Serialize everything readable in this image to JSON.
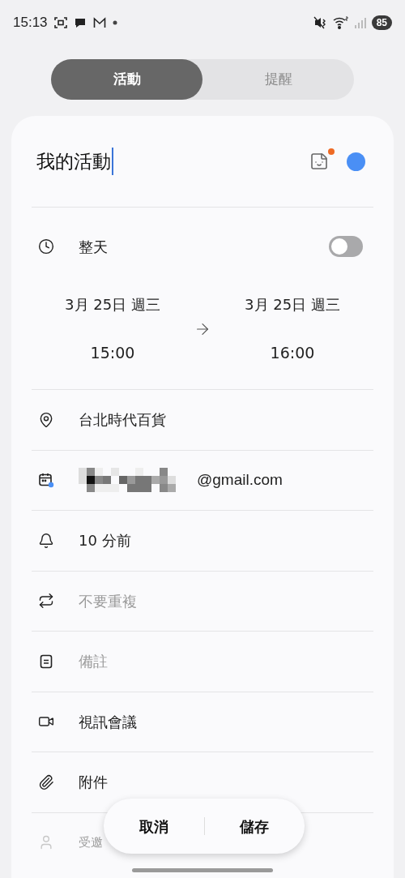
{
  "status_bar": {
    "time": "15:13",
    "battery": "85"
  },
  "tabs": [
    {
      "label": "活動",
      "selected": true
    },
    {
      "label": "提醒",
      "selected": false
    }
  ],
  "title": {
    "value": "我的活動",
    "color": "#4a8ff5",
    "sticker_badge": true
  },
  "all_day": {
    "label": "整天",
    "on": false
  },
  "start": {
    "date": "3月 25日 週三",
    "time": "15:00"
  },
  "end": {
    "date": "3月 25日 週三",
    "time": "16:00"
  },
  "rows": [
    {
      "kind": "location",
      "value": "台北時代百貨"
    },
    {
      "kind": "calendar",
      "value": "@gmail.com",
      "redacted": true
    },
    {
      "kind": "reminder",
      "value": "10 分前"
    },
    {
      "kind": "repeat",
      "placeholder": "不要重複"
    },
    {
      "kind": "note",
      "placeholder": "備註"
    },
    {
      "kind": "video",
      "value": "視訊會議"
    },
    {
      "kind": "attachment",
      "value": "附件"
    },
    {
      "kind": "invitees",
      "placeholder": "受邀"
    }
  ],
  "buttons": [
    "取消",
    "儲存"
  ]
}
